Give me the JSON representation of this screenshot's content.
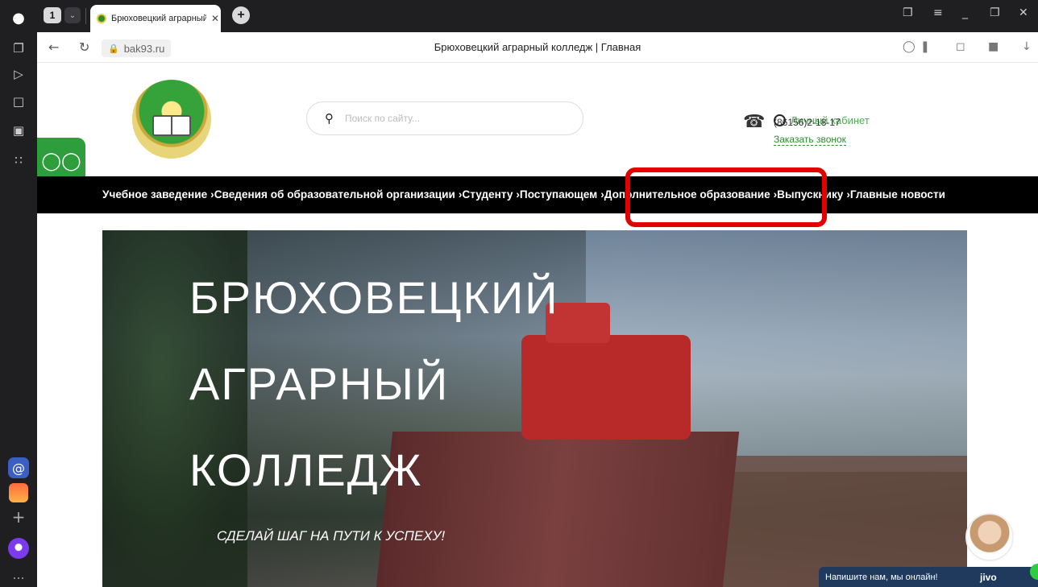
{
  "browser": {
    "tab_count": "1",
    "tab_title": "Брюховецкий аграрный",
    "url": "bak93.ru",
    "page_title": "Брюховецкий аграрный колледж | Главная"
  },
  "site": {
    "search_placeholder": "Поиск по сайту...",
    "cabinet_label": "Личный кабинет",
    "phone": "(86156)2-18-17",
    "callback_label": "Заказать звонок"
  },
  "nav": {
    "items": [
      "Учебное заведение",
      "›Сведения об образовательной организации",
      "›Студенту",
      "›Поступающем",
      "›Дополнительное образование",
      "›Выпускнику",
      "›Главные новости"
    ]
  },
  "hero": {
    "title_lines": [
      "БРЮХОВЕЦКИЙ",
      "АГРАРНЫЙ",
      "КОЛЛЕДЖ"
    ],
    "subtitle": "СДЕЛАЙ ШАГ НА ПУТИ К УСПЕХУ!"
  },
  "chat": {
    "label": "Напишите нам, мы онлайн!",
    "brand": "jivo"
  },
  "colors": {
    "accent_green": "#2e9d3c",
    "highlight_red": "#e30000",
    "nav_bg": "#000000"
  }
}
